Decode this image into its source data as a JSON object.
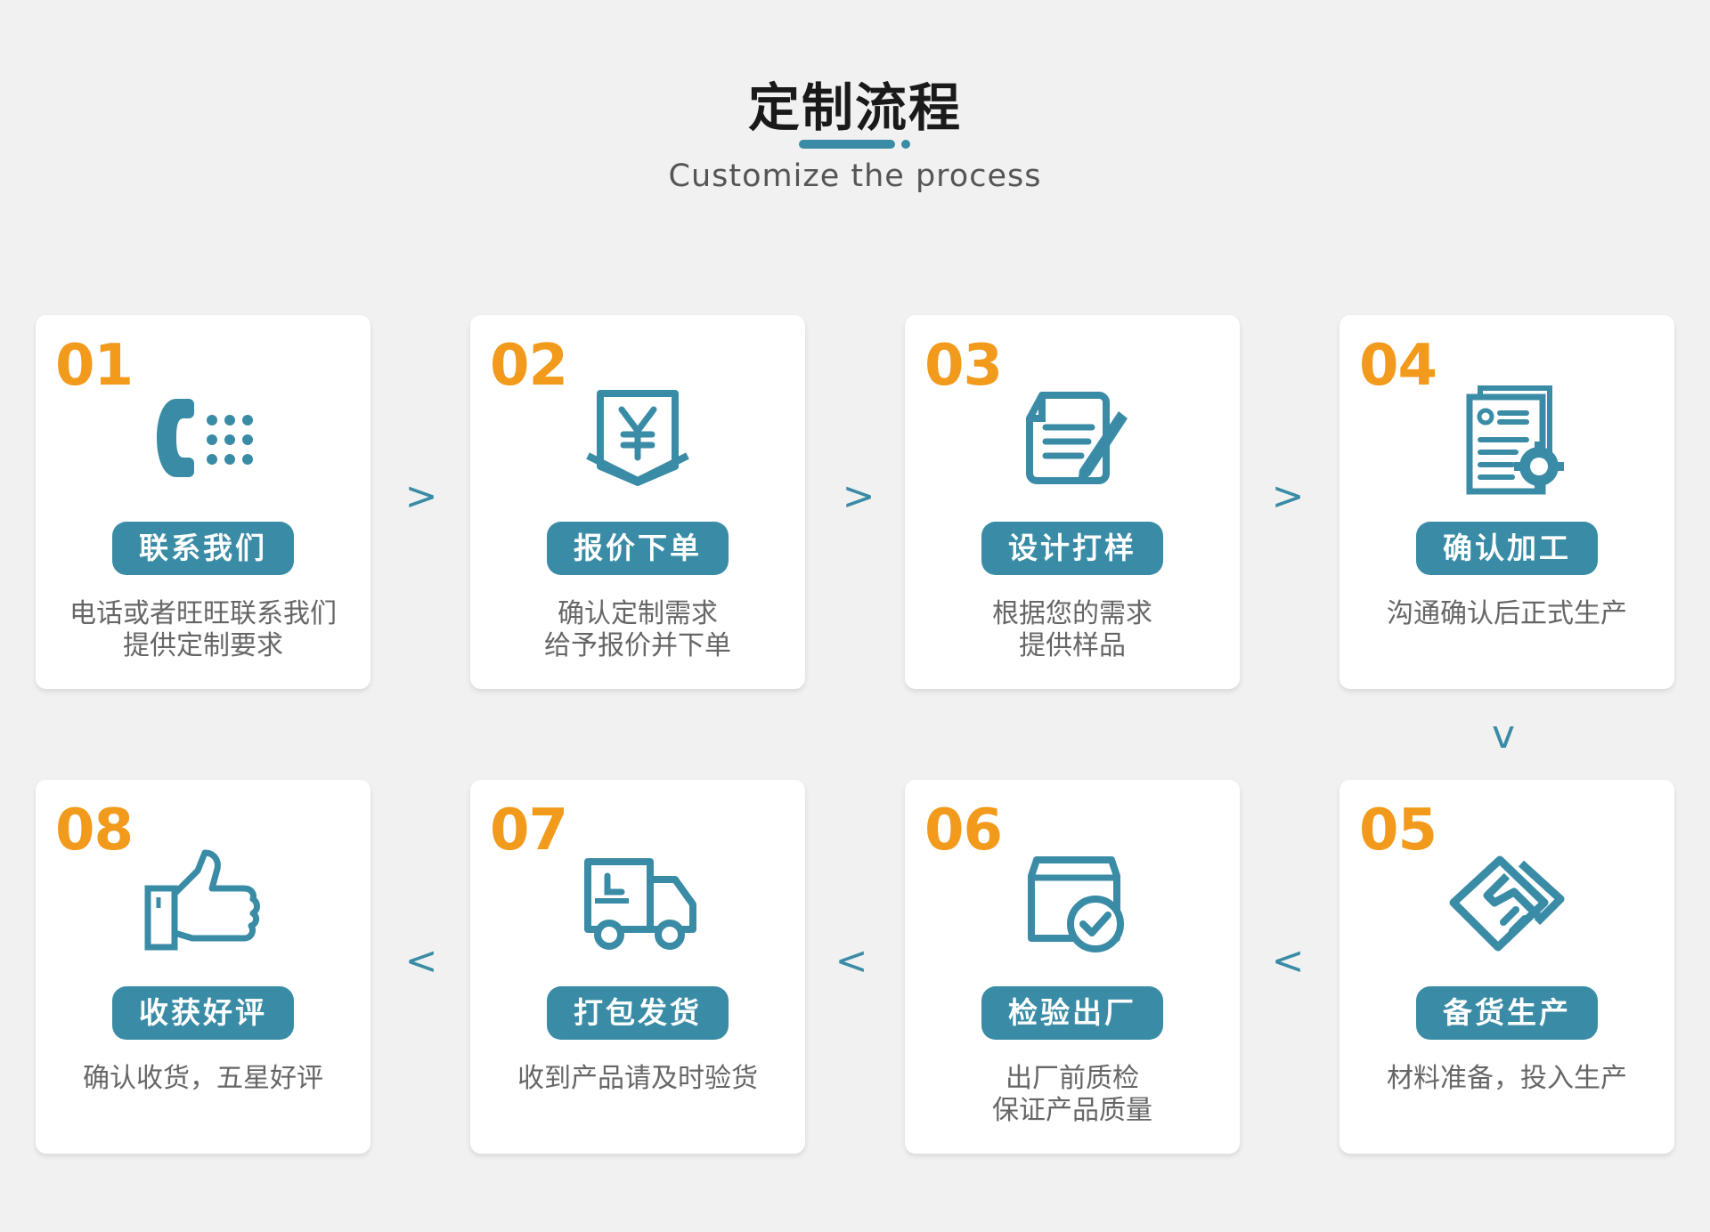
{
  "header": {
    "title": "定制流程",
    "subtitle": "Customize the process"
  },
  "colors": {
    "accent": "#3a8ca6",
    "number": "#f29a1b",
    "background": "#f1f1f1"
  },
  "steps": [
    {
      "num": "01",
      "icon": "phone-icon",
      "label": "联系我们",
      "desc": [
        "电话或者旺旺联系我们",
        "提供定制要求"
      ]
    },
    {
      "num": "02",
      "icon": "yen-icon",
      "label": "报价下单",
      "desc": [
        "确认定制需求",
        "给予报价并下单"
      ]
    },
    {
      "num": "03",
      "icon": "document-pen-icon",
      "label": "设计打样",
      "desc": [
        "根据您的需求",
        "提供样品"
      ]
    },
    {
      "num": "04",
      "icon": "document-gear-icon",
      "label": "确认加工",
      "desc": [
        "沟通确认后正式生产"
      ]
    },
    {
      "num": "05",
      "icon": "handshake-icon",
      "label": "备货生产",
      "desc": [
        "材料准备，投入生产"
      ]
    },
    {
      "num": "06",
      "icon": "box-check-icon",
      "label": "检验出厂",
      "desc": [
        "出厂前质检",
        "保证产品质量"
      ]
    },
    {
      "num": "07",
      "icon": "truck-icon",
      "label": "打包发货",
      "desc": [
        "收到产品请及时验货"
      ]
    },
    {
      "num": "08",
      "icon": "thumbs-up-icon",
      "label": "收获好评",
      "desc": [
        "确认收货，五星好评"
      ]
    }
  ],
  "arrows": {
    "right": ">",
    "left": "<",
    "down": "v"
  }
}
